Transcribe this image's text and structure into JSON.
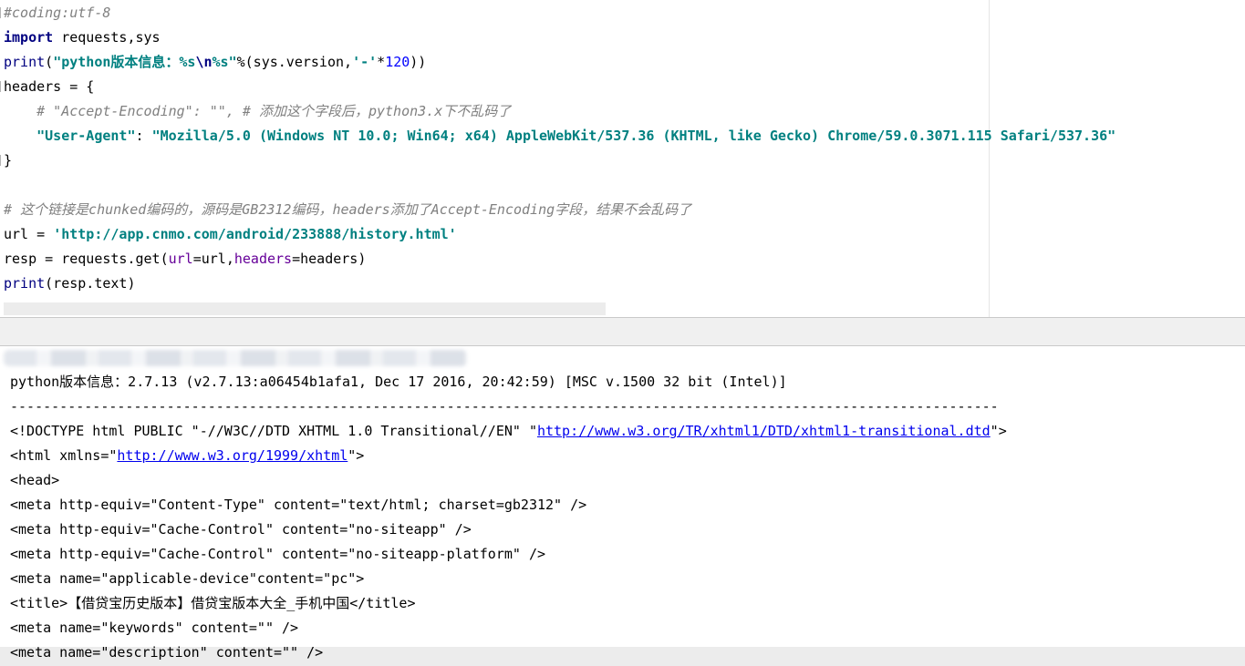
{
  "editor": {
    "line1_comment": "#coding:utf-8",
    "line2_kw": "import",
    "line2_rest": " requests,sys",
    "line3_fn": "print",
    "line3_open": "(",
    "line3_str_a": "\"python版本信息：%s",
    "line3_esc": "\\n",
    "line3_str_b": "%s\"",
    "line3_mid": "%(sys.version,",
    "line3_str_c": "'-'",
    "line3_op": "*",
    "line3_num": "120",
    "line3_close": "))",
    "line4": "headers = {",
    "line5_indent": "    ",
    "line5_comment": "# \"Accept-Encoding\": \"\", # 添加这个字段后，python3.x下不乱码了",
    "line6_indent": "    ",
    "line6_key": "\"User-Agent\"",
    "line6_colon": ": ",
    "line6_val": "\"Mozilla/5.0 (Windows NT 10.0; Win64; x64) AppleWebKit/537.36 (KHTML, like Gecko) Chrome/59.0.3071.115 Safari/537.36\"",
    "line7": "}",
    "line8": "",
    "line9_comment": "# 这个链接是chunked编码的，源码是GB2312编码，headers添加了Accept-Encoding字段，结果不会乱码了",
    "line10_a": "url = ",
    "line10_str": "'http://app.cnmo.com/android/233888/history.html'",
    "line11_a": "resp = requests.get(",
    "line11_p1": "url",
    "line11_b": "=url,",
    "line11_p2": "headers",
    "line11_c": "=headers)",
    "line12_fn": "print",
    "line12_rest": "(resp.text)"
  },
  "console": {
    "out1": "python版本信息：2.7.13 (v2.7.13:a06454b1afa1, Dec 17 2016, 20:42:59) [MSC v.1500 32 bit (Intel)]",
    "out2": "------------------------------------------------------------------------------------------------------------------------",
    "out3_a": "<!DOCTYPE html PUBLIC \"-//W3C//DTD XHTML 1.0 Transitional//EN\" \"",
    "out3_link": "http://www.w3.org/TR/xhtml1/DTD/xhtml1-transitional.dtd",
    "out3_b": "\">",
    "out4_a": "<html xmlns=\"",
    "out4_link": "http://www.w3.org/1999/xhtml",
    "out4_b": "\">",
    "out5": "<head>",
    "out6": "<meta http-equiv=\"Content-Type\" content=\"text/html; charset=gb2312\" />",
    "out7": "<meta http-equiv=\"Cache-Control\" content=\"no-siteapp\" />",
    "out8": "<meta http-equiv=\"Cache-Control\" content=\"no-siteapp-platform\" />",
    "out9": "<meta name=\"applicable-device\"content=\"pc\">",
    "out10": "<title>【借贷宝历史版本】借贷宝版本大全_手机中国</title>",
    "out11": "<meta name=\"keywords\" content=\"\" />",
    "out12": "<meta name=\"description\" content=\"\" />"
  }
}
